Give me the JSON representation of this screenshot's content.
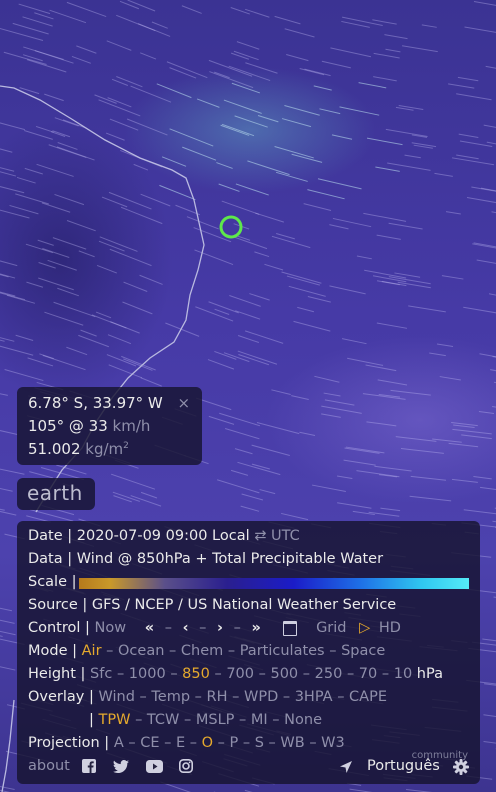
{
  "spot": {
    "coords": "6.78° S, 33.97° W",
    "close": "×",
    "wind_value": "105° @ 33",
    "wind_unit": "km/h",
    "tpw_value": "51.002",
    "tpw_unit": "kg/m",
    "tpw_sup": "2"
  },
  "earth_label": "earth",
  "menu": {
    "date_label": "Date |",
    "date_value": "2020-07-09 09:00 Local",
    "swap_icon": "⇄",
    "utc_label": "UTC",
    "data_label": "Data |",
    "data_value": "Wind @ 850hPa + Total Precipitable Water",
    "scale_label": "Scale |",
    "source_label": "Source |",
    "source_value": "GFS / NCEP / US National Weather Service",
    "control_label": "Control |",
    "control_now": "Now",
    "control_prev_day": "«",
    "control_prev": "‹",
    "control_next": "›",
    "control_next_day": "»",
    "control_sep": "–",
    "control_grid": "Grid",
    "control_play": "▷",
    "control_hd": "HD",
    "mode_label": "Mode |",
    "modes": [
      "Air",
      "Ocean",
      "Chem",
      "Particulates",
      "Space"
    ],
    "mode_selected": "Air",
    "height_label": "Height |",
    "heights": [
      "Sfc",
      "1000",
      "850",
      "700",
      "500",
      "250",
      "70",
      "10"
    ],
    "height_selected": "850",
    "height_unit": "hPa",
    "overlay_label": "Overlay |",
    "overlays_row1": [
      "Wind",
      "Temp",
      "RH",
      "WPD",
      "3HPA",
      "CAPE"
    ],
    "overlays_row2": [
      "TPW",
      "TCW",
      "MSLP",
      "MI",
      "None"
    ],
    "overlay_selected": "TPW",
    "projection_label": "Projection |",
    "projections": [
      "A",
      "CE",
      "E",
      "O",
      "P",
      "S",
      "WB",
      "W3"
    ],
    "projection_selected": "O",
    "about": "about",
    "language": "Português",
    "community": "community"
  },
  "colors": {
    "highlight": "#e5a92d",
    "marker": "#5ee84a"
  }
}
